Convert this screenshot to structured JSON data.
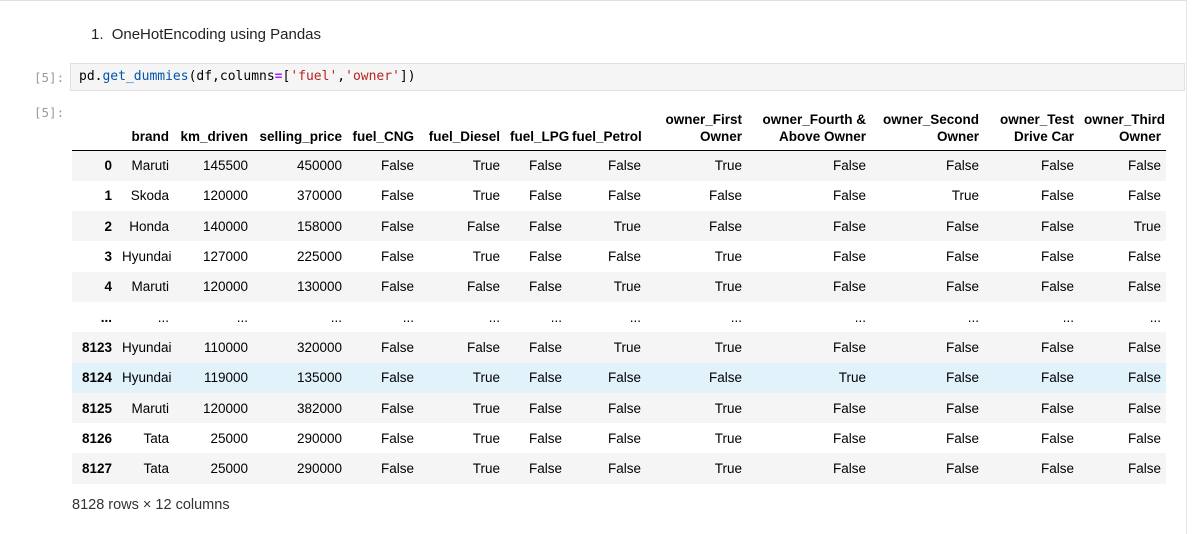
{
  "markdown": {
    "number": "1.",
    "text": "OneHotEncoding using Pandas"
  },
  "prompts": {
    "in": "[5]:",
    "out": "[5]:"
  },
  "code": {
    "p1": "pd.",
    "p2": "get_dummies",
    "p3": "(df,columns",
    "p4": "=",
    "p5": "[",
    "p6": "'fuel'",
    "p7": ",",
    "p8": "'owner'",
    "p9": "])"
  },
  "table": {
    "columns": [
      "",
      "brand",
      "km_driven",
      "selling_price",
      "fuel_CNG",
      "fuel_Diesel",
      "fuel_LPG",
      "fuel_Petrol",
      "owner_First Owner",
      "owner_Fourth & Above Owner",
      "owner_Second Owner",
      "owner_Test Drive Car",
      "owner_Third Owner"
    ],
    "rows": [
      [
        "0",
        "Maruti",
        "145500",
        "450000",
        "False",
        "True",
        "False",
        "False",
        "True",
        "False",
        "False",
        "False",
        "False"
      ],
      [
        "1",
        "Skoda",
        "120000",
        "370000",
        "False",
        "True",
        "False",
        "False",
        "False",
        "False",
        "True",
        "False",
        "False"
      ],
      [
        "2",
        "Honda",
        "140000",
        "158000",
        "False",
        "False",
        "False",
        "True",
        "False",
        "False",
        "False",
        "False",
        "True"
      ],
      [
        "3",
        "Hyundai",
        "127000",
        "225000",
        "False",
        "True",
        "False",
        "False",
        "True",
        "False",
        "False",
        "False",
        "False"
      ],
      [
        "4",
        "Maruti",
        "120000",
        "130000",
        "False",
        "False",
        "False",
        "True",
        "True",
        "False",
        "False",
        "False",
        "False"
      ],
      [
        "...",
        "...",
        "...",
        "...",
        "...",
        "...",
        "...",
        "...",
        "...",
        "...",
        "...",
        "...",
        "..."
      ],
      [
        "8123",
        "Hyundai",
        "110000",
        "320000",
        "False",
        "False",
        "False",
        "True",
        "True",
        "False",
        "False",
        "False",
        "False"
      ],
      [
        "8124",
        "Hyundai",
        "119000",
        "135000",
        "False",
        "True",
        "False",
        "False",
        "False",
        "True",
        "False",
        "False",
        "False"
      ],
      [
        "8125",
        "Maruti",
        "120000",
        "382000",
        "False",
        "True",
        "False",
        "False",
        "True",
        "False",
        "False",
        "False",
        "False"
      ],
      [
        "8126",
        "Tata",
        "25000",
        "290000",
        "False",
        "True",
        "False",
        "False",
        "True",
        "False",
        "False",
        "False",
        "False"
      ],
      [
        "8127",
        "Tata",
        "25000",
        "290000",
        "False",
        "True",
        "False",
        "False",
        "True",
        "False",
        "False",
        "False",
        "False"
      ]
    ],
    "highlight_row": "8124"
  },
  "footer": "8128 rows × 12 columns",
  "colors": {
    "code_bg": "#f5f5f5",
    "stripe": "#f5f5f5",
    "hover": "#e1f2fb",
    "string": "#ba2121",
    "function": "#0055aa",
    "operator": "#aa22ff"
  }
}
